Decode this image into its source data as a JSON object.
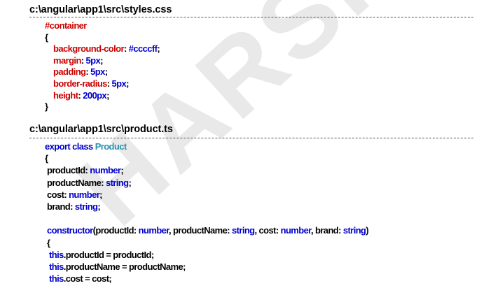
{
  "file1": {
    "path": "c:\\angular\\app1\\src\\styles.css",
    "lines": [
      [
        {
          "t": "#container",
          "c": "red"
        }
      ],
      [
        {
          "t": "{",
          "c": "blk"
        }
      ],
      [
        {
          "t": "    background-color",
          "c": "red"
        },
        {
          "t": ": ",
          "c": "blk"
        },
        {
          "t": "#ccccff",
          "c": "blue"
        },
        {
          "t": ";",
          "c": "blk"
        }
      ],
      [
        {
          "t": "    margin",
          "c": "red"
        },
        {
          "t": ": ",
          "c": "blk"
        },
        {
          "t": "5px",
          "c": "blue"
        },
        {
          "t": ";",
          "c": "blk"
        }
      ],
      [
        {
          "t": "    padding",
          "c": "red"
        },
        {
          "t": ": ",
          "c": "blk"
        },
        {
          "t": "5px",
          "c": "blue"
        },
        {
          "t": ";",
          "c": "blk"
        }
      ],
      [
        {
          "t": "    border-radius",
          "c": "red"
        },
        {
          "t": ": ",
          "c": "blk"
        },
        {
          "t": "5px",
          "c": "blue"
        },
        {
          "t": ";",
          "c": "blk"
        }
      ],
      [
        {
          "t": "    height",
          "c": "red"
        },
        {
          "t": ": ",
          "c": "blk"
        },
        {
          "t": "200px",
          "c": "blue"
        },
        {
          "t": ";",
          "c": "blk"
        }
      ],
      [
        {
          "t": "}",
          "c": "blk"
        }
      ]
    ]
  },
  "file2": {
    "path": "c:\\angular\\app1\\src\\product.ts",
    "lines": [
      [
        {
          "t": "export class ",
          "c": "kw"
        },
        {
          "t": "Product",
          "c": "cls"
        }
      ],
      [
        {
          "t": "{",
          "c": "blk"
        }
      ],
      [
        {
          "t": " productId: ",
          "c": "blk"
        },
        {
          "t": "number",
          "c": "kw"
        },
        {
          "t": ";",
          "c": "blk"
        }
      ],
      [
        {
          "t": " productName: ",
          "c": "blk"
        },
        {
          "t": "string",
          "c": "kw"
        },
        {
          "t": ";",
          "c": "blk"
        }
      ],
      [
        {
          "t": " cost: ",
          "c": "blk"
        },
        {
          "t": "number",
          "c": "kw"
        },
        {
          "t": ";",
          "c": "blk"
        }
      ],
      [
        {
          "t": " brand: ",
          "c": "blk"
        },
        {
          "t": "string",
          "c": "kw"
        },
        {
          "t": ";",
          "c": "blk"
        }
      ],
      [
        {
          "t": "",
          "c": "blk"
        }
      ],
      [
        {
          "t": " constructor",
          "c": "kw"
        },
        {
          "t": "(productId: ",
          "c": "blk"
        },
        {
          "t": "number",
          "c": "kw"
        },
        {
          "t": ", productName: ",
          "c": "blk"
        },
        {
          "t": "string",
          "c": "kw"
        },
        {
          "t": ", cost: ",
          "c": "blk"
        },
        {
          "t": "number",
          "c": "kw"
        },
        {
          "t": ", brand: ",
          "c": "blk"
        },
        {
          "t": "string",
          "c": "kw"
        },
        {
          "t": ")",
          "c": "blk"
        }
      ],
      [
        {
          "t": " {",
          "c": "blk"
        }
      ],
      [
        {
          "t": "  this",
          "c": "kw"
        },
        {
          "t": ".productId = productId;",
          "c": "blk"
        }
      ],
      [
        {
          "t": "  this",
          "c": "kw"
        },
        {
          "t": ".productName = productName;",
          "c": "blk"
        }
      ],
      [
        {
          "t": "  this",
          "c": "kw"
        },
        {
          "t": ".cost = cost;",
          "c": "blk"
        }
      ]
    ]
  },
  "colors": {
    "red": "#cc0000",
    "blue": "#0000cc",
    "class": "#2b91af",
    "black": "#000000"
  },
  "watermark": "HARSHA"
}
